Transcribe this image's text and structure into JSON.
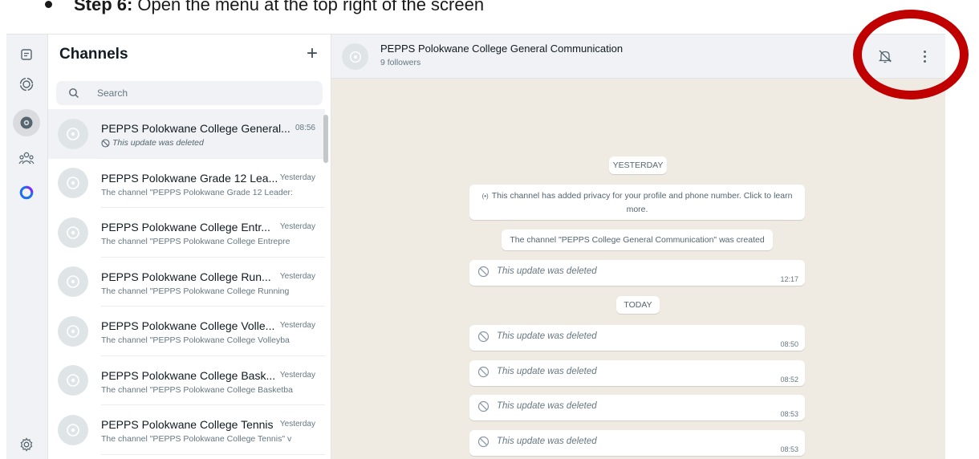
{
  "instruction": {
    "step": "Step 6:",
    "text": "Open the menu at the top right of the screen"
  },
  "panel": {
    "title": "Channels",
    "add_label": "+",
    "search_placeholder": "Search"
  },
  "channels": [
    {
      "name": "PEPPS Polokwane College General...",
      "time": "08:56",
      "preview": "This update was deleted",
      "preview_deleted": true,
      "selected": true
    },
    {
      "name": "PEPPS Polokwane Grade 12 Lea...",
      "time": "Yesterday",
      "preview": "The channel \"PEPPS Polokwane Grade 12 Leader:",
      "preview_deleted": false,
      "selected": false
    },
    {
      "name": "PEPPS Polokwane College Entr...",
      "time": "Yesterday",
      "preview": "The channel \"PEPPS Polokwane College Entrepre",
      "preview_deleted": false,
      "selected": false
    },
    {
      "name": "PEPPS Polokwane College Run...",
      "time": "Yesterday",
      "preview": "The channel \"PEPPS Polokwane College Running",
      "preview_deleted": false,
      "selected": false
    },
    {
      "name": "PEPPS Polokwane College Volle...",
      "time": "Yesterday",
      "preview": "The channel \"PEPPS Polokwane College Volleyba",
      "preview_deleted": false,
      "selected": false
    },
    {
      "name": "PEPPS Polokwane College Bask...",
      "time": "Yesterday",
      "preview": "The channel \"PEPPS Polokwane College Basketba",
      "preview_deleted": false,
      "selected": false
    },
    {
      "name": "PEPPS Polokwane College Tennis",
      "time": "Yesterday",
      "preview": "The channel \"PEPPS Polokwane College Tennis\" v",
      "preview_deleted": false,
      "selected": false
    }
  ],
  "conversation": {
    "title": "PEPPS Polokwane College General Communication",
    "subtitle": "9 followers",
    "date_yesterday": "YESTERDAY",
    "privacy_notice": "This channel has added privacy for your profile and phone number. Click to learn more.",
    "privacy_icon": "(•)",
    "created_notice": "The channel \"PEPPS College General Communication\" was created",
    "date_today": "TODAY",
    "messages": [
      {
        "text": "This update was deleted",
        "time": "12:17"
      },
      {
        "text": "This update was deleted",
        "time": "08:50"
      },
      {
        "text": "This update was deleted",
        "time": "08:52"
      },
      {
        "text": "This update was deleted",
        "time": "08:53"
      },
      {
        "text": "This update was deleted",
        "time": "08:53"
      }
    ]
  },
  "icons": {
    "rail": [
      "chats-icon",
      "status-icon",
      "channels-icon",
      "communities-icon",
      "meta-ai-icon"
    ],
    "settings": "settings-icon",
    "mute": "bell-off-icon",
    "menu": "kebab-menu-icon"
  },
  "colors": {
    "highlight_ring": "#c00000",
    "chat_background": "#efeae2",
    "meta_ai_ring": "#1e6ff0"
  }
}
